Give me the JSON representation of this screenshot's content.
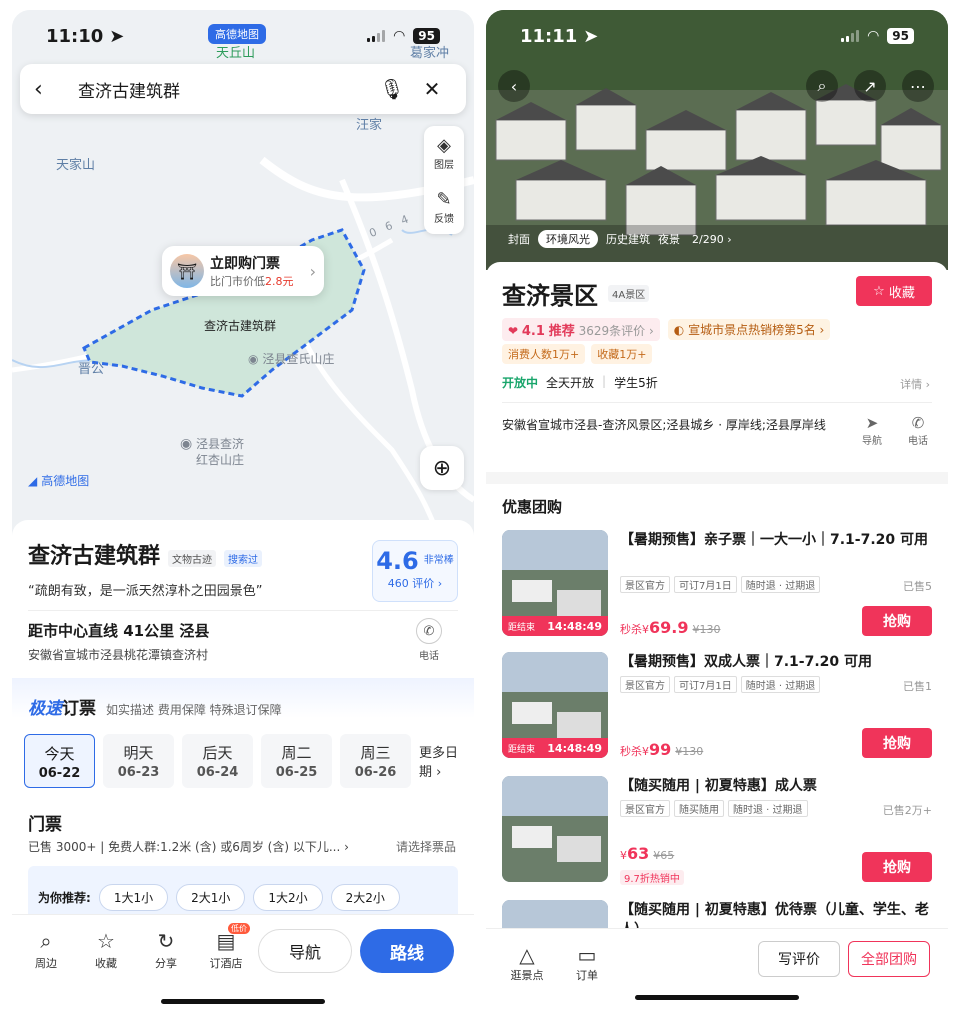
{
  "left": {
    "status": {
      "time": "11:10",
      "battery": "95"
    },
    "amap_pill": "高德地图",
    "search": {
      "query": "查济古建筑群"
    },
    "map_labels": {
      "tianjiashan": "天家山",
      "wangjia": "汪家",
      "jingong": "晋公",
      "top_poi": "天丘山",
      "top_right": "葛家冲",
      "road": "064"
    },
    "map_tools": {
      "layers": "图层",
      "feedback": "反馈"
    },
    "ticket_bubble": {
      "title": "立即购门票",
      "sub_prefix": "比门市价低",
      "sub_value": "2.8元"
    },
    "poi_label": "查济古建筑群",
    "pins": {
      "zha_manor": "泾县查氏山庄",
      "redapricot_l1": "泾县查济",
      "redapricot_l2": "红杏山庄"
    },
    "brand": "高德地图",
    "poi": {
      "title": "查济古建筑群",
      "tag1": "文物古迹",
      "tag2": "搜索过",
      "quote": "“疏朗有致，是一派天然淳朴之田园景色”",
      "score": "4.6",
      "level": "非常棒",
      "reviews": "460 评价 ›",
      "distance": "距市中心直线 41公里  泾县",
      "address": "安徽省宣城市泾县桃花潭镇查济村",
      "phone_label": "电话"
    },
    "fastbook": {
      "title_highlight": "极速",
      "title_rest": "订票",
      "sub": "如实描述  费用保障  特殊退订保障"
    },
    "dates": [
      {
        "day": "今天",
        "date": "06-22"
      },
      {
        "day": "明天",
        "date": "06-23"
      },
      {
        "day": "后天",
        "date": "06-24"
      },
      {
        "day": "周二",
        "date": "06-25"
      },
      {
        "day": "周三",
        "date": "06-26"
      }
    ],
    "more_dates": "更多日期",
    "tickets": {
      "title": "门票",
      "sub": "已售 3000+ | 免费人群:1.2米 (含) 或6周岁 (含) 以下儿...  ›",
      "pick": "请选择票品"
    },
    "recommend": {
      "label": "为你推荐:",
      "chips": [
        "1大1小",
        "2大1小",
        "1大2小",
        "2大2小"
      ]
    },
    "bottom_tabs": [
      {
        "icon": "search-icon",
        "label": "周边"
      },
      {
        "icon": "star-icon",
        "label": "收藏"
      },
      {
        "icon": "share-icon",
        "label": "分享"
      },
      {
        "icon": "hotel-icon",
        "label": "订酒店",
        "badge": "低价"
      }
    ],
    "nav_label": "导航",
    "route_label": "路线"
  },
  "right": {
    "status": {
      "time": "11:11",
      "battery": "95"
    },
    "gallery_tabs": [
      "封面",
      "环境风光",
      "历史建筑",
      "夜景"
    ],
    "gallery_count": "2/290 ›",
    "scenic": {
      "title": "查济景区",
      "grade": "4A景区",
      "fav": "收藏",
      "score": "4.1",
      "recommend": "推荐",
      "reviews": "3629条评价 ›",
      "rank": "宣城市景点热销榜第5名 ›",
      "consumers": "消费人数1万+",
      "collects": "收藏1万+",
      "open": "开放中",
      "hours": "全天开放",
      "student": "学生5折",
      "detail": "详情 ›",
      "address": "安徽省宣城市泾县-查济风景区;泾县城乡 · 厚岸线;泾县厚岸线",
      "nav": "导航",
      "phone": "电话"
    },
    "deals_title": "优惠团购",
    "deals": [
      {
        "title": "【暑期预售】亲子票｜一大一小｜7.1-7.20 可用",
        "tags": [
          "景区官方",
          "可订7月1日",
          "随时退 · 过期退"
        ],
        "sold": "已售5",
        "price_prefix": "秒杀¥",
        "price": "69.9",
        "orig": "¥130",
        "countdown_label": "距结束",
        "countdown": "14:48:49"
      },
      {
        "title": "【暑期预售】双成人票｜7.1-7.20 可用",
        "tags": [
          "景区官方",
          "可订7月1日",
          "随时退 · 过期退"
        ],
        "sold": "已售1",
        "price_prefix": "秒杀¥",
        "price": "99",
        "orig": "¥130",
        "countdown_label": "距结束",
        "countdown": "14:48:49"
      },
      {
        "title": "【随买随用 | 初夏特惠】成人票",
        "tags": [
          "景区官方",
          "随买随用",
          "随时退 · 过期退"
        ],
        "sold": "已售2万+",
        "price_prefix": "¥",
        "price": "63",
        "orig": "¥65",
        "hot": "9.7折热销中"
      }
    ],
    "deal4_title": "【随买随用 | 初夏特惠】优待票（儿童、学生、老人）",
    "buy_label": "抢购",
    "bottom": {
      "explore": "逛景点",
      "orders": "订单",
      "write_review": "写评价",
      "all_deals": "全部团购"
    }
  }
}
